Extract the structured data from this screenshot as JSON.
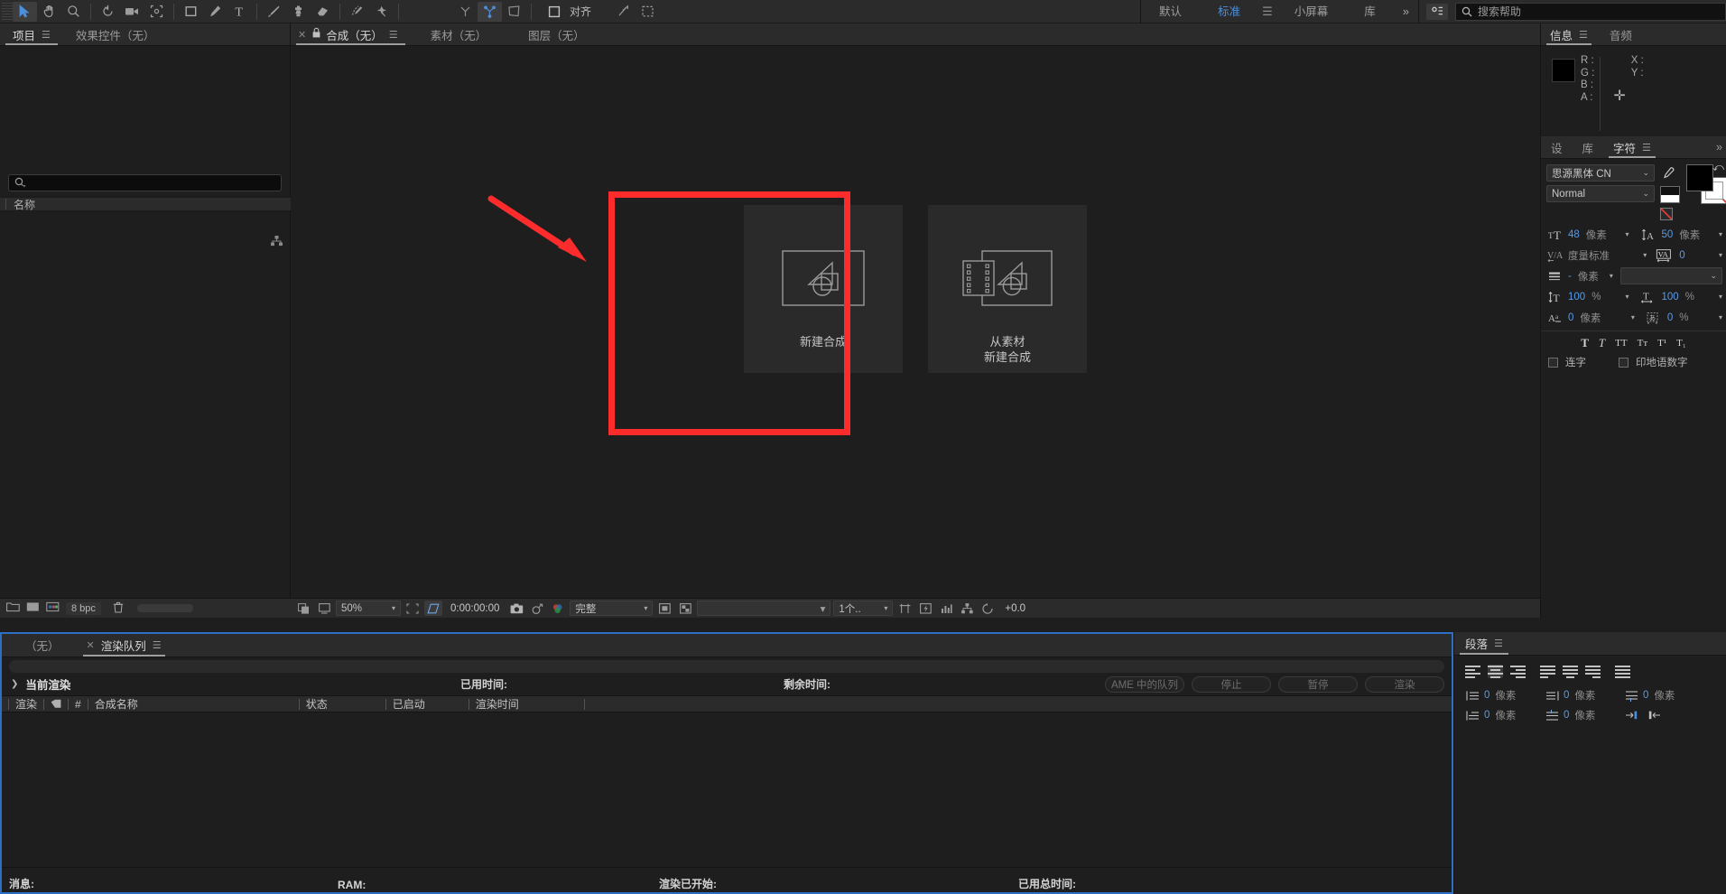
{
  "toolbar": {
    "tools": [
      {
        "name": "selection-tool",
        "icon": "cursor",
        "selected": true
      },
      {
        "name": "hand-tool",
        "icon": "hand",
        "selected": false
      },
      {
        "name": "zoom-tool",
        "icon": "magnifier",
        "selected": false
      },
      {
        "name": "rotation-tool",
        "icon": "rotate",
        "selected": false
      },
      {
        "name": "camera-tool",
        "icon": "camera",
        "selected": false
      },
      {
        "name": "pan-behind-tool",
        "icon": "anchor-point",
        "selected": false
      },
      {
        "name": "shape-tool",
        "icon": "rectangle",
        "selected": false
      },
      {
        "name": "pen-tool",
        "icon": "pen",
        "selected": false
      },
      {
        "name": "type-tool",
        "icon": "type",
        "selected": false
      },
      {
        "name": "brush-tool",
        "icon": "brush",
        "selected": false
      },
      {
        "name": "clone-stamp-tool",
        "icon": "stamp",
        "selected": false
      },
      {
        "name": "eraser-tool",
        "icon": "eraser",
        "selected": false
      },
      {
        "name": "roto-brush-tool",
        "icon": "roto-brush",
        "selected": false
      },
      {
        "name": "puppet-pin-tool",
        "icon": "puppet-pin",
        "selected": false
      },
      {
        "name": "unified-camera-tool",
        "icon": "axis-single",
        "selected": false
      },
      {
        "name": "orbit-tool",
        "icon": "axis-triple",
        "selected": true
      },
      {
        "name": "pan-camera-tool",
        "icon": "axis-frame",
        "selected": false
      }
    ],
    "align_toggle_label": "对齐",
    "workspaces": [
      {
        "label": "默认",
        "active": false
      },
      {
        "label": "标准",
        "active": true
      },
      {
        "label": "小屏幕",
        "active": false
      },
      {
        "label": "库",
        "active": false
      }
    ],
    "overflow_label": "»",
    "search_placeholder": "搜索帮助",
    "accent_blue": "#4b8fdd"
  },
  "project_panel": {
    "tabs": [
      {
        "label": "项目",
        "active": true,
        "has_menu": true
      },
      {
        "label": "效果控件（无）",
        "active": false,
        "has_menu": false
      }
    ],
    "search_value": "",
    "column_header": "名称",
    "bit_depth": "8 bpc"
  },
  "comp_panel": {
    "tabs": [
      {
        "label": "合成（无）",
        "active": true,
        "closable": true,
        "locked": true,
        "has_menu": true
      },
      {
        "label": "素材（无）",
        "active": false
      },
      {
        "label": "图层（无）",
        "active": false
      }
    ],
    "cards": [
      {
        "title": "新建合成",
        "icon": "new-composition",
        "highlighted": true
      },
      {
        "title": "从素材\n新建合成",
        "icon": "new-composition-from-footage",
        "highlighted": false
      }
    ],
    "highlight_color": "#fc2c2c",
    "footer": {
      "zoom": "50%",
      "timecode": "0:00:00:00",
      "resolution": "完整",
      "views": "1个..",
      "exposure": "+0.0"
    }
  },
  "info_panel": {
    "tabs": [
      {
        "label": "信息",
        "active": true,
        "has_menu": true
      },
      {
        "label": "音频",
        "active": false
      }
    ],
    "channels": [
      "R :",
      "G :",
      "B :",
      "A :"
    ],
    "coords": [
      "X :",
      "Y :"
    ]
  },
  "character_panel": {
    "tabs": [
      {
        "label": "设",
        "active": false
      },
      {
        "label": "库",
        "active": false
      },
      {
        "label": "字符",
        "active": true,
        "has_menu": true
      }
    ],
    "font_family": "思源黑体 CN",
    "font_style": "Normal",
    "font_size": "48",
    "font_size_unit": "像素",
    "leading": "50",
    "leading_unit": "像素",
    "kerning": "度量标准",
    "tracking": "0",
    "stroke_width": "-",
    "stroke_width_unit": "像素",
    "stroke_type": "",
    "vertical_scale": "100",
    "vertical_scale_unit": "%",
    "horizontal_scale": "100",
    "horizontal_scale_unit": "%",
    "baseline_shift": "0",
    "baseline_shift_unit": "像素",
    "tsume": "0",
    "tsume_unit": "%",
    "style_buttons": [
      "T",
      "T",
      "TT",
      "Tт",
      "T¹",
      "T₁"
    ],
    "ligature_label": "连字",
    "hindi_digits_label": "印地语数字"
  },
  "render_queue": {
    "tabs": [
      {
        "label": "（无）",
        "active": false
      },
      {
        "label": "渲染队列",
        "active": true,
        "closable": true,
        "has_menu": true
      }
    ],
    "current_render_label": "当前渲染",
    "elapsed_label": "已用时间:",
    "remaining_label": "剩余时间:",
    "buttons": [
      {
        "label": "AME 中的队列",
        "enabled": false
      },
      {
        "label": "停止",
        "enabled": false
      },
      {
        "label": "暂停",
        "enabled": false
      },
      {
        "label": "渲染",
        "enabled": false
      }
    ],
    "columns": [
      "渲染",
      "",
      "#",
      "合成名称",
      "状态",
      "已启动",
      "渲染时间"
    ],
    "rows": [],
    "status_bar": [
      {
        "label": "消息:"
      },
      {
        "label": "RAM:"
      },
      {
        "label": "渲染已开始:"
      },
      {
        "label": "已用总时间:"
      }
    ],
    "selection_border_color": "#2c6fc4"
  },
  "paragraph_panel": {
    "tabs": [
      {
        "label": "段落",
        "active": true,
        "has_menu": true
      }
    ],
    "align_buttons": [
      "align-left",
      "align-center",
      "align-right",
      "justify-last-left",
      "justify-last-center",
      "justify-last-right",
      "justify-all"
    ],
    "indent_left": "0",
    "indent_right": "0",
    "indent_first": "0",
    "space_before": "0",
    "space_after": "0",
    "unit": "像素"
  }
}
